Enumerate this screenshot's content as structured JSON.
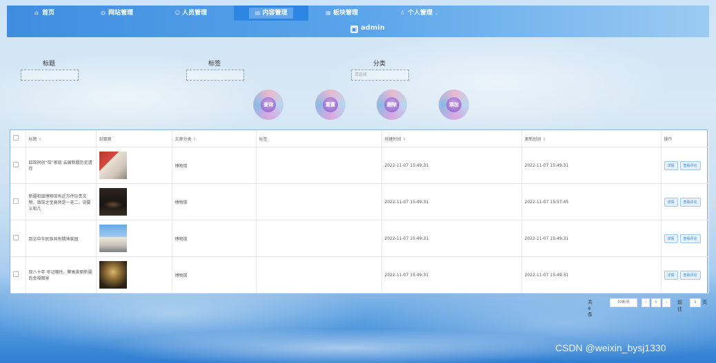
{
  "nav": {
    "items": [
      "首页",
      "网站管理",
      "人员管理",
      "内容管理",
      "板块管理",
      "个人管理"
    ],
    "active_index": 3,
    "user": "admin"
  },
  "search": {
    "labels": {
      "title": "标题",
      "tag": "标签",
      "category": "分类"
    },
    "category_placeholder": "请选择"
  },
  "actions": [
    "查询",
    "重置",
    "删除",
    "添加"
  ],
  "table": {
    "headers": [
      "标题",
      "封面图",
      "文章分类",
      "标签",
      "创建时间",
      "更新时间",
      "操作"
    ],
    "rows": [
      {
        "title": "四馆同创“馆”家庭 云展新疆历史遗存",
        "category": "博物馆",
        "tag": "",
        "created": "2022-11-07 15:49:31",
        "updated": "2022-11-07 15:49:31"
      },
      {
        "title": "新疆和田博物馆有近万件珍贵文物，镇馆之宝竟然是一无二，说要义和几",
        "category": "博物馆",
        "tag": "",
        "created": "2022-11-07 15:49:31",
        "updated": "2022-11-07 15:57:45"
      },
      {
        "title": "到访中华民族共有精神家园",
        "category": "博物馆",
        "tag": "",
        "created": "2022-11-07 15:49:31",
        "updated": "2022-11-07 15:49:31"
      },
      {
        "title": "双八十年 牢记嘱托，攀高美丽新疆的幸福图景",
        "category": "博物馆",
        "tag": "",
        "created": "2022-11-07 15:49:31",
        "updated": "2022-11-07 15:49:31"
      }
    ],
    "row_buttons": {
      "detail": "详情",
      "comments": "查看评论"
    }
  },
  "pager": {
    "total": "共 4 条",
    "page_size": "10条/页",
    "current": "1",
    "goto_label": "前往",
    "goto_value": "1",
    "suffix": "页"
  },
  "watermark": "CSDN @weixin_bysj1330"
}
